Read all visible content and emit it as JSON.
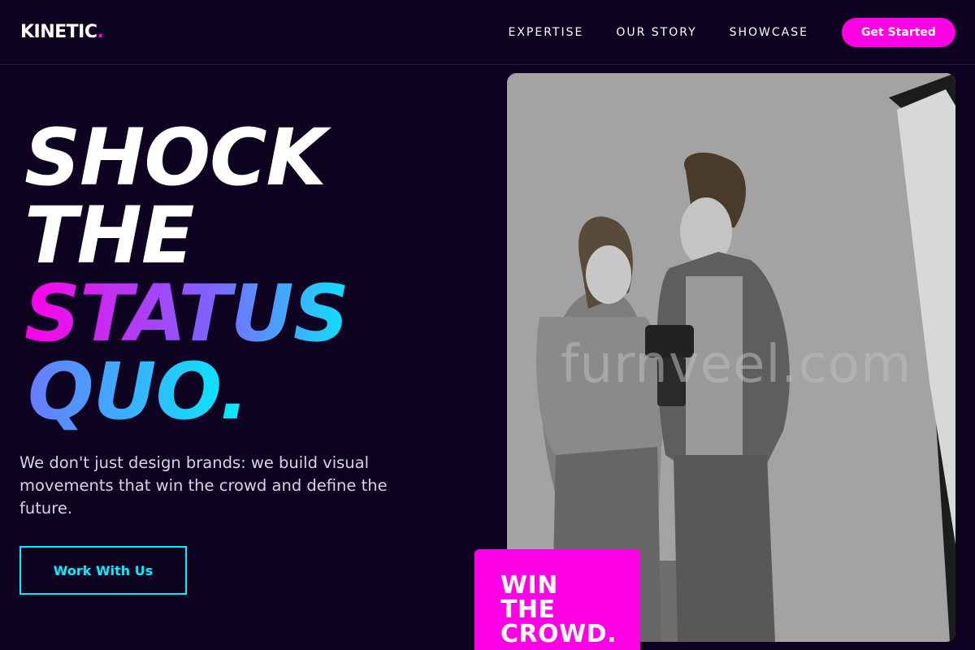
{
  "brand": {
    "name": "KINETIC",
    "dot": "."
  },
  "nav": {
    "links": [
      "EXPERTISE",
      "OUR STORY",
      "SHOWCASE"
    ],
    "cta": "Get Started"
  },
  "hero": {
    "line1": "SHOCK",
    "line2": "THE",
    "line3": "STATUS",
    "line4": "QUO.",
    "subtitle": "We don't just design brands: we build visual movements that win the crowd and define the future.",
    "button": "Work With Us"
  },
  "photo": {
    "watermark": "furnveel.com"
  },
  "badge": {
    "line1": "WIN",
    "line2": "THE",
    "line3": "CROWD."
  },
  "colors": {
    "background": "#0f0322",
    "accent": "#ff00e6",
    "cyan": "#00f2ff"
  }
}
